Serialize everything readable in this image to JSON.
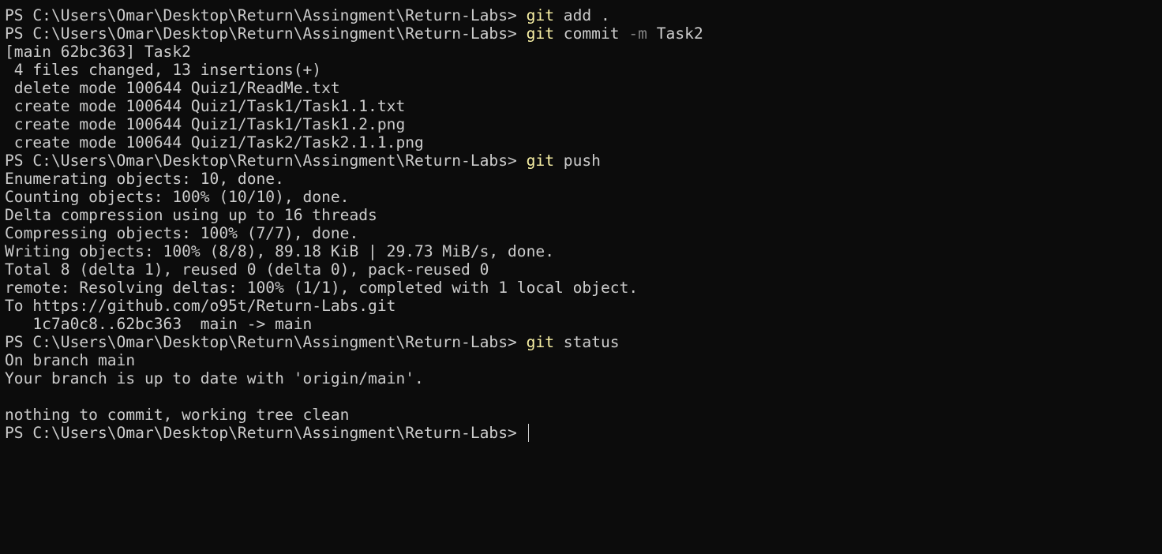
{
  "terminal": {
    "prompt": "PS C:\\Users\\Omar\\Desktop\\Return\\Assingment\\Return-Labs> ",
    "colors": {
      "background": "#0c0c0c",
      "text": "#cccccc",
      "command": "#f9f1a5",
      "flag": "#808080"
    },
    "lines": [
      {
        "type": "cmd",
        "command": "git",
        "rest": " add ."
      },
      {
        "type": "cmd",
        "command": "git",
        "rest": " commit ",
        "flag": "-m",
        "after": " Task2"
      },
      {
        "type": "out",
        "text": "[main 62bc363] Task2"
      },
      {
        "type": "out",
        "text": " 4 files changed, 13 insertions(+)"
      },
      {
        "type": "out",
        "text": " delete mode 100644 Quiz1/ReadMe.txt"
      },
      {
        "type": "out",
        "text": " create mode 100644 Quiz1/Task1/Task1.1.txt"
      },
      {
        "type": "out",
        "text": " create mode 100644 Quiz1/Task1/Task1.2.png"
      },
      {
        "type": "out",
        "text": " create mode 100644 Quiz1/Task2/Task2.1.1.png"
      },
      {
        "type": "cmd",
        "command": "git",
        "rest": " push"
      },
      {
        "type": "out",
        "text": "Enumerating objects: 10, done."
      },
      {
        "type": "out",
        "text": "Counting objects: 100% (10/10), done."
      },
      {
        "type": "out",
        "text": "Delta compression using up to 16 threads"
      },
      {
        "type": "out",
        "text": "Compressing objects: 100% (7/7), done."
      },
      {
        "type": "out",
        "text": "Writing objects: 100% (8/8), 89.18 KiB | 29.73 MiB/s, done."
      },
      {
        "type": "out",
        "text": "Total 8 (delta 1), reused 0 (delta 0), pack-reused 0"
      },
      {
        "type": "out",
        "text": "remote: Resolving deltas: 100% (1/1), completed with 1 local object."
      },
      {
        "type": "out",
        "text": "To https://github.com/o95t/Return-Labs.git"
      },
      {
        "type": "out",
        "text": "   1c7a0c8..62bc363  main -> main"
      },
      {
        "type": "cmd",
        "command": "git",
        "rest": " status"
      },
      {
        "type": "out",
        "text": "On branch main"
      },
      {
        "type": "out",
        "text": "Your branch is up to date with 'origin/main'."
      },
      {
        "type": "out",
        "text": ""
      },
      {
        "type": "out",
        "text": "nothing to commit, working tree clean"
      },
      {
        "type": "prompt"
      }
    ]
  }
}
